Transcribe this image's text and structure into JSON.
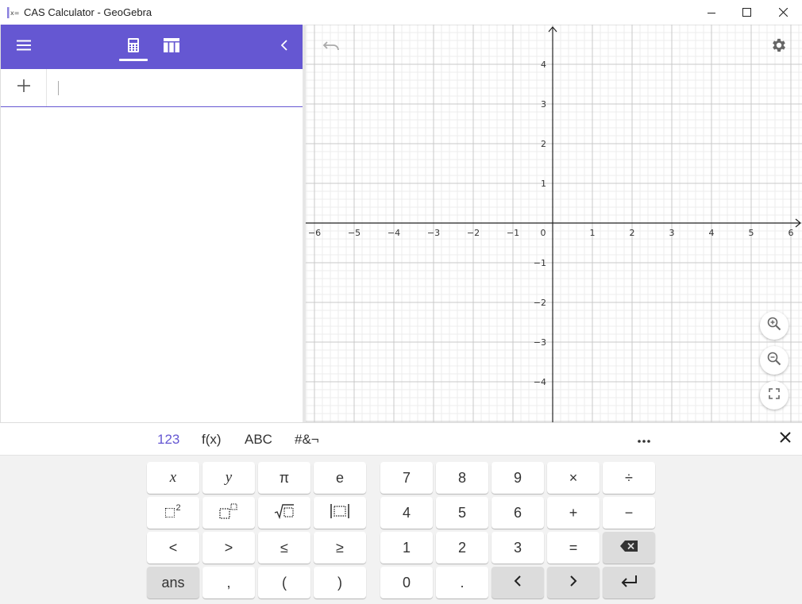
{
  "window": {
    "title": "CAS Calculator - GeoGebra",
    "controls": [
      "minimize",
      "maximize",
      "close"
    ]
  },
  "left_panel": {
    "header": {
      "menu_icon": "hamburger-icon",
      "tabs": [
        {
          "name": "algebra",
          "icon": "calculator-icon",
          "active": true
        },
        {
          "name": "table",
          "icon": "table-icon",
          "active": false
        }
      ],
      "collapse_icon": "chevron-left-icon",
      "accent": "#6557d2"
    },
    "input_row": {
      "add_icon": "plus-icon",
      "value": ""
    }
  },
  "graphics": {
    "x_ticks": [
      "−6",
      "−5",
      "−4",
      "−3",
      "−2",
      "−1",
      "0",
      "1",
      "2",
      "3",
      "4",
      "5",
      "6"
    ],
    "y_ticks": [
      "4",
      "3",
      "2",
      "1",
      "−1",
      "−2",
      "−3",
      "−4"
    ],
    "undo_icon": "undo-icon",
    "settings_icon": "gear-icon",
    "zoom_in_icon": "zoom-in-icon",
    "zoom_out_icon": "zoom-out-icon",
    "fullscreen_icon": "fullscreen-icon"
  },
  "keyboard": {
    "tabs": [
      {
        "label": "123",
        "active": true
      },
      {
        "label": "f(x)",
        "active": false
      },
      {
        "label": "ABC",
        "active": false
      },
      {
        "label": "#&¬",
        "active": false
      }
    ],
    "more_icon": "more-icon",
    "close_icon": "close-icon",
    "left_keys": [
      [
        "x",
        "y",
        "π",
        "e"
      ],
      [
        "square",
        "power",
        "sqrt",
        "abs"
      ],
      [
        "<",
        ">",
        "≤",
        "≥"
      ],
      [
        "ans",
        ",",
        "(",
        ")"
      ]
    ],
    "power_label": "2",
    "right_keys": [
      [
        "7",
        "8",
        "9",
        "×",
        "÷"
      ],
      [
        "4",
        "5",
        "6",
        "+",
        "−"
      ],
      [
        "1",
        "2",
        "3",
        "=",
        "backspace"
      ],
      [
        "0",
        ".",
        "left",
        "right",
        "enter"
      ]
    ]
  }
}
